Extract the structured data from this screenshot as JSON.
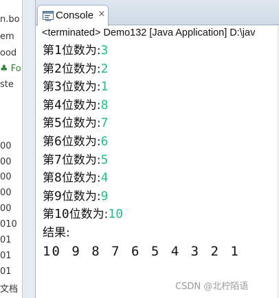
{
  "left_panel": {
    "fragments": [
      "n.bo",
      "em",
      "ood",
      "Fo",
      "ste",
      "00",
      "00",
      "00",
      "00",
      "00",
      "010",
      "01",
      "01",
      "01",
      "文档"
    ]
  },
  "console": {
    "tab_label": "Console",
    "tab_icon": "console-icon",
    "close_glyph": "×",
    "status": "<terminated> Demo132 [Java Application] D:\\jav",
    "lines": [
      {
        "prefix": "第",
        "num": "1",
        "suffix": "位数为:",
        "value": "3"
      },
      {
        "prefix": "第",
        "num": "2",
        "suffix": "位数为:",
        "value": "2"
      },
      {
        "prefix": "第",
        "num": "3",
        "suffix": "位数为:",
        "value": "1"
      },
      {
        "prefix": "第",
        "num": "4",
        "suffix": "位数为:",
        "value": "8"
      },
      {
        "prefix": "第",
        "num": "5",
        "suffix": "位数为:",
        "value": "7"
      },
      {
        "prefix": "第",
        "num": "6",
        "suffix": "位数为:",
        "value": "6"
      },
      {
        "prefix": "第",
        "num": "7",
        "suffix": "位数为:",
        "value": "5"
      },
      {
        "prefix": "第",
        "num": "8",
        "suffix": "位数为:",
        "value": "4"
      },
      {
        "prefix": "第",
        "num": "9",
        "suffix": "位数为:",
        "value": "9"
      },
      {
        "prefix": "第",
        "num": "10",
        "suffix": "位数为:",
        "value": "10"
      }
    ],
    "result_label": "结果:",
    "result_values": "10 9 8 7 6 5 4 3 2 1"
  },
  "watermark": "CSDN @北柠陌语",
  "colors": {
    "value_green": "#1fbf8f",
    "text": "#111111"
  }
}
